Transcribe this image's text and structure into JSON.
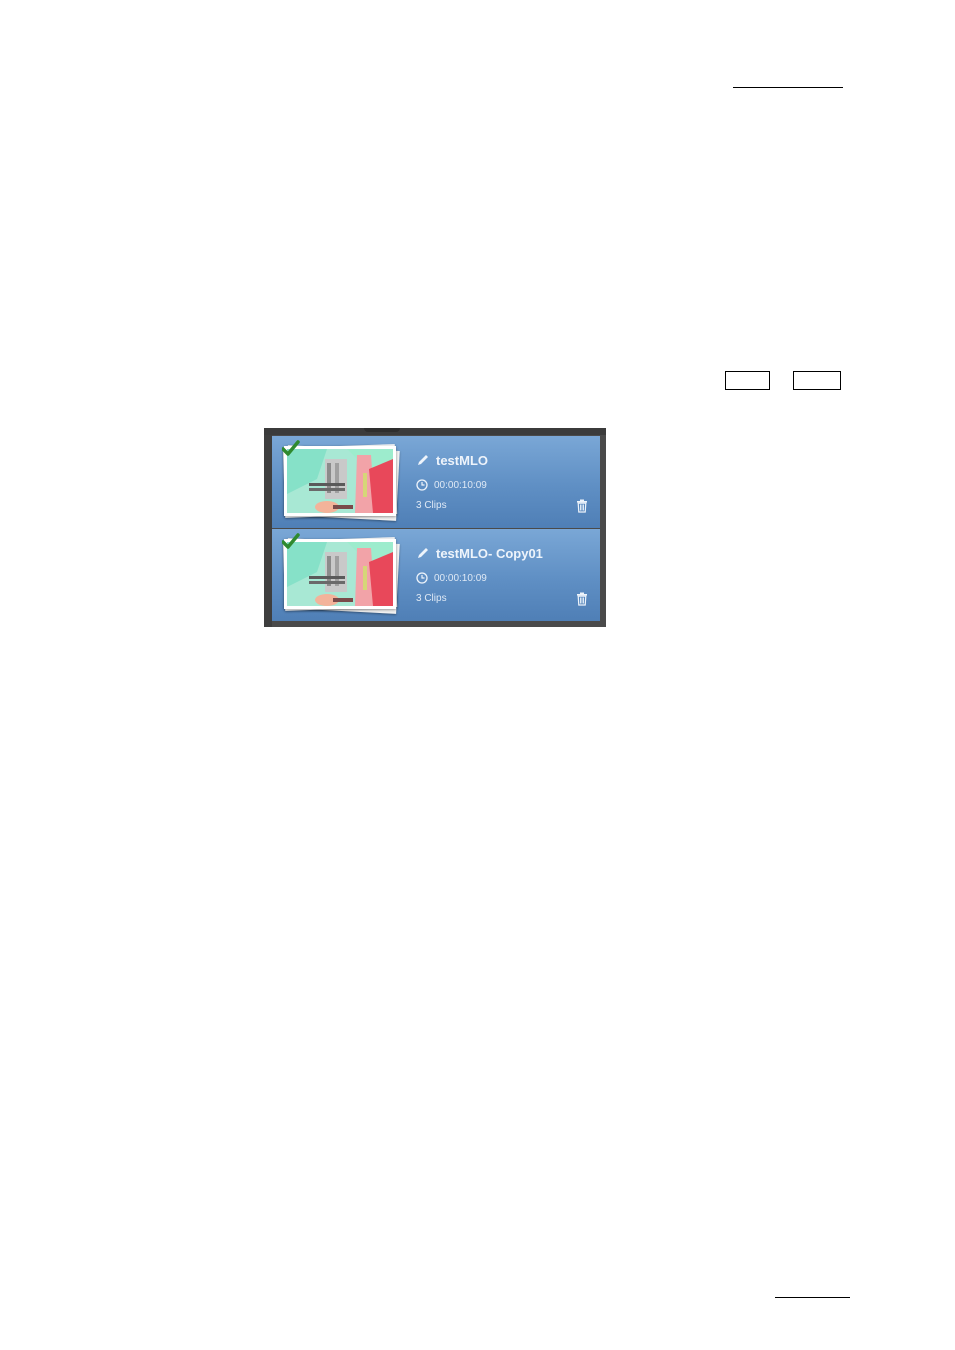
{
  "mlo_list": {
    "items": [
      {
        "name": "testMLO",
        "duration": "00:00:10:09",
        "clips": "3 Clips",
        "selected": true,
        "icons": [
          "check-icon",
          "pencil-icon",
          "clock-icon",
          "trash-icon"
        ]
      },
      {
        "name": "testMLO- Copy01",
        "duration": "00:00:10:09",
        "clips": "3 Clips",
        "selected": true,
        "icons": [
          "check-icon",
          "pencil-icon",
          "clock-icon",
          "trash-icon"
        ]
      }
    ]
  },
  "colors": {
    "item_background": "#6a98cb",
    "panel_background": "#4a4a4a",
    "check_mark": "#2f8a2f",
    "text": "#eef4fb"
  }
}
